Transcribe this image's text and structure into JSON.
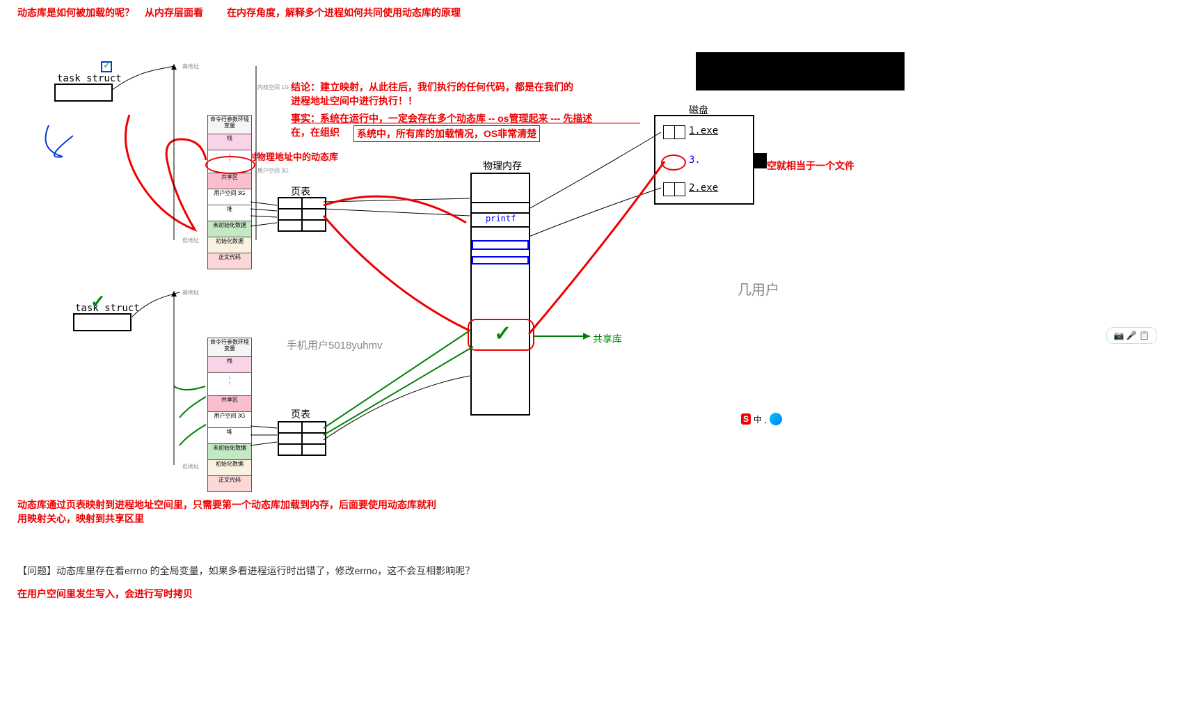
{
  "header": {
    "q1": "动态库是如何被加载的呢？",
    "persp": "从内存层面看",
    "q2": "在内存角度，解释多个进程如何共同使用动态库的原理"
  },
  "task_struct": {
    "label": "task_struct"
  },
  "conclusion": {
    "line1": "结论：建立映射，从此往后，我们执行的任何代码，都是在我们的",
    "line2": "进程地址空间中进行执行！！",
    "fact": "事实：系统在运行中，一定会存在多个动态库 -- os管理起来 --- 先描述",
    "fact2": "在，在组织",
    "boxed": "系统中，所有库的加载情况，OS非常清楚"
  },
  "anno": {
    "map_note": "映射物理地址中的动态库",
    "page_table": "页表",
    "phys_mem": "物理内存",
    "printf": "printf",
    "watermark": "手机用户5018yuhmv",
    "shared_lib": "共享库",
    "disk": "磁盘",
    "file1": "1.exe",
    "file2": "2.exe",
    "file3": "3.",
    "equiv": "空就相当于一个文件",
    "users": "几用户",
    "arrow_hi": "高地址",
    "arrow_lo": "低地址",
    "kspace": "内核空间 1G",
    "uspace": "用户空间 3G"
  },
  "segnames": {
    "kernel": "命令行参数环境变量",
    "stack": "栈",
    "share": "共享区",
    "heap": "堆",
    "uninit": "未初始化数据",
    "init": "初始化数据",
    "code": "正文代码"
  },
  "footer": {
    "summary1": "动态库通过页表映射到进程地址空间里，只需要第一个动态库加载到内存，后面要使用动态库就利",
    "summary2": "用映射关心，映射到共享区里",
    "question": "【问题】动态库里存在着errno 的全局变量，如果多看进程运行时出错了，修改errno，这不会互相影响呢？",
    "answer": "在用户空间里发生写入，会进行写时拷贝"
  },
  "toolbar": {
    "icons": "📷 🎤 📋"
  },
  "ime": {
    "s": "S",
    "label": "中 ,"
  }
}
